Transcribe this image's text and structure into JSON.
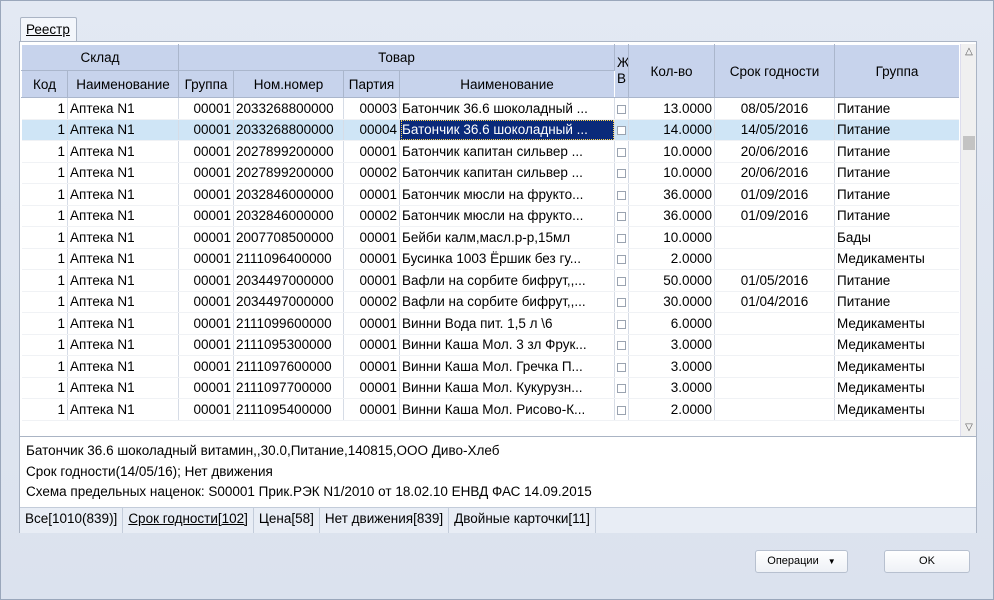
{
  "tab": "Реестр",
  "headers": {
    "group_sklad": "Склад",
    "group_tovar": "Товар",
    "zhv": "Ж\nВ",
    "kolvo": "Кол-во",
    "srok": "Срок годности",
    "gruppa": "Группа",
    "kod": "Код",
    "naim_sklad": "Наименование",
    "gruppa_tov": "Группа",
    "nom": "Ном.номер",
    "partiya": "Партия",
    "naim_tov": "Наименование"
  },
  "rows": [
    {
      "kod": "1",
      "sklad": "Аптека N1",
      "grp": "00001",
      "nom": "2033268800000",
      "part": "00003",
      "name": "Батончик 36.6 шоколадный ...",
      "qty": "13.0000",
      "srok": "08/05/2016",
      "group": "Питание"
    },
    {
      "kod": "1",
      "sklad": "Аптека N1",
      "grp": "00001",
      "nom": "2033268800000",
      "part": "00004",
      "name": "Батончик 36.6 шоколадный ...",
      "qty": "14.0000",
      "srok": "14/05/2016",
      "group": "Питание"
    },
    {
      "kod": "1",
      "sklad": "Аптека N1",
      "grp": "00001",
      "nom": "2027899200000",
      "part": "00001",
      "name": "Батончик капитан сильвер ...",
      "qty": "10.0000",
      "srok": "20/06/2016",
      "group": "Питание"
    },
    {
      "kod": "1",
      "sklad": "Аптека N1",
      "grp": "00001",
      "nom": "2027899200000",
      "part": "00002",
      "name": "Батончик капитан сильвер ...",
      "qty": "10.0000",
      "srok": "20/06/2016",
      "group": "Питание"
    },
    {
      "kod": "1",
      "sklad": "Аптека N1",
      "grp": "00001",
      "nom": "2032846000000",
      "part": "00001",
      "name": "Батончик мюсли на фрукто...",
      "qty": "36.0000",
      "srok": "01/09/2016",
      "group": "Питание"
    },
    {
      "kod": "1",
      "sklad": "Аптека N1",
      "grp": "00001",
      "nom": "2032846000000",
      "part": "00002",
      "name": "Батончик мюсли на фрукто...",
      "qty": "36.0000",
      "srok": "01/09/2016",
      "group": "Питание"
    },
    {
      "kod": "1",
      "sklad": "Аптека N1",
      "grp": "00001",
      "nom": "2007708500000",
      "part": "00001",
      "name": "Бейби калм,масл.р-р,15мл",
      "qty": "10.0000",
      "srok": "",
      "group": "Бады"
    },
    {
      "kod": "1",
      "sklad": "Аптека N1",
      "grp": "00001",
      "nom": "2111096400000",
      "part": "00001",
      "name": "Бусинка 1003 Ёршик без гу...",
      "qty": "2.0000",
      "srok": "",
      "group": "Медикаменты"
    },
    {
      "kod": "1",
      "sklad": "Аптека N1",
      "grp": "00001",
      "nom": "2034497000000",
      "part": "00001",
      "name": "Вафли на сорбите бифрут,,...",
      "qty": "50.0000",
      "srok": "01/05/2016",
      "group": "Питание"
    },
    {
      "kod": "1",
      "sklad": "Аптека N1",
      "grp": "00001",
      "nom": "2034497000000",
      "part": "00002",
      "name": "Вафли на сорбите бифрут,,...",
      "qty": "30.0000",
      "srok": "01/04/2016",
      "group": "Питание"
    },
    {
      "kod": "1",
      "sklad": "Аптека N1",
      "grp": "00001",
      "nom": "2111099600000",
      "part": "00001",
      "name": "Винни Вода пит. 1,5 л \\6",
      "qty": "6.0000",
      "srok": "",
      "group": "Медикаменты"
    },
    {
      "kod": "1",
      "sklad": "Аптека N1",
      "grp": "00001",
      "nom": "2111095300000",
      "part": "00001",
      "name": "Винни Каша Мол. 3 зл Фрук...",
      "qty": "3.0000",
      "srok": "",
      "group": "Медикаменты"
    },
    {
      "kod": "1",
      "sklad": "Аптека N1",
      "grp": "00001",
      "nom": "2111097600000",
      "part": "00001",
      "name": "Винни Каша Мол. Гречка П...",
      "qty": "3.0000",
      "srok": "",
      "group": "Медикаменты"
    },
    {
      "kod": "1",
      "sklad": "Аптека N1",
      "grp": "00001",
      "nom": "2111097700000",
      "part": "00001",
      "name": "Винни Каша Мол. Кукурузн...",
      "qty": "3.0000",
      "srok": "",
      "group": "Медикаменты"
    },
    {
      "kod": "1",
      "sklad": "Аптека N1",
      "grp": "00001",
      "nom": "2111095400000",
      "part": "00001",
      "name": "Винни Каша Мол. Рисово-К...",
      "qty": "2.0000",
      "srok": "",
      "group": "Медикаменты"
    }
  ],
  "selected_row": 1,
  "info": {
    "line1": "Батончик 36.6 шоколадный витамин,,30.0,Питание,140815,ООО Диво-Хлеб",
    "line2": "Срок годности(14/05/16); Нет движения",
    "line3": "Схема предельных наценок: S00001 Прик.РЭК N1/2010 от 18.02.10 ЕНВД ФАС 14.09.2015"
  },
  "filters": [
    {
      "label": "Все[1010(839)]",
      "active": false
    },
    {
      "label": "Срок годности[102]",
      "active": true
    },
    {
      "label": "Цена[58]",
      "active": false
    },
    {
      "label": "Нет движения[839]",
      "active": false
    },
    {
      "label": "Двойные карточки[11]",
      "active": false
    }
  ],
  "buttons": {
    "operations": "Операции",
    "ok": "OK"
  },
  "icons": {
    "scroll_up": "chevron-up-icon",
    "scroll_down": "chevron-down-icon",
    "dropdown": "caret-down-icon"
  }
}
